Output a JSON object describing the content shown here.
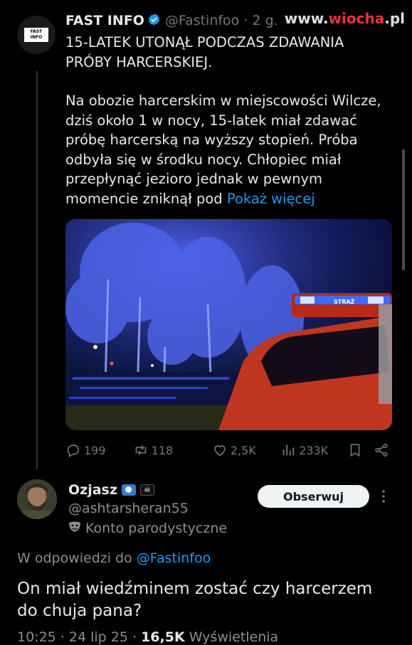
{
  "watermark": {
    "prefix": "www.",
    "brand": "wiocha",
    "suffix": ".pl"
  },
  "post": {
    "avatar_logo": "FAST INFO",
    "author_name": "FAST INFO",
    "handle": "@Fastinfoo",
    "time": "· 2 g.",
    "headline_1": "15-LATEK UTONĄŁ PODCZAS ZDAWANIA",
    "headline_2": "PRÓBY HARCERSKIEJ.",
    "body_lines": [
      "Na obozie harcerskim w miejscowości Wilcze,",
      "dziś około 1 w nocy, 15-latek miał zdawać",
      "próbę harcerską na wyższy stopień. Próba",
      "odbyła się w środku nocy. Chłopiec miał",
      "przepłynąć jezioro jednak w pewnym"
    ],
    "last_line": "momencie zniknął pod",
    "show_more": "Pokaż więcej",
    "media_vehicle_label": "STRAŻ",
    "stats": {
      "replies": "199",
      "reposts": "118",
      "likes": "2,5K",
      "views": "233K"
    }
  },
  "reply": {
    "author_name": "Ozjasz",
    "handle": "@ashtarsheran55",
    "parody_label": "Konto parodystyczne",
    "follow_label": "Obserwuj",
    "reply_to_prefix": "W odpowiedzi do",
    "reply_to_handle": "@Fastinfoo",
    "text_line_1": "On miał wiedźminem zostać czy harcerzem",
    "text_line_2": "do chuja pana?",
    "time": "10:25 · 24 lip 25 ·",
    "views_count": "16,5K",
    "views_label": "Wyświetlenia"
  },
  "colors": {
    "accent": "#1d9bf0",
    "muted": "#71767b",
    "background": "#000000",
    "watermark_red": "#ee3333"
  },
  "icons": [
    "verified-badge-icon",
    "reply-icon",
    "repost-icon",
    "like-icon",
    "views-icon",
    "bookmark-icon",
    "share-icon",
    "more-icon",
    "parody-mask-icon"
  ]
}
